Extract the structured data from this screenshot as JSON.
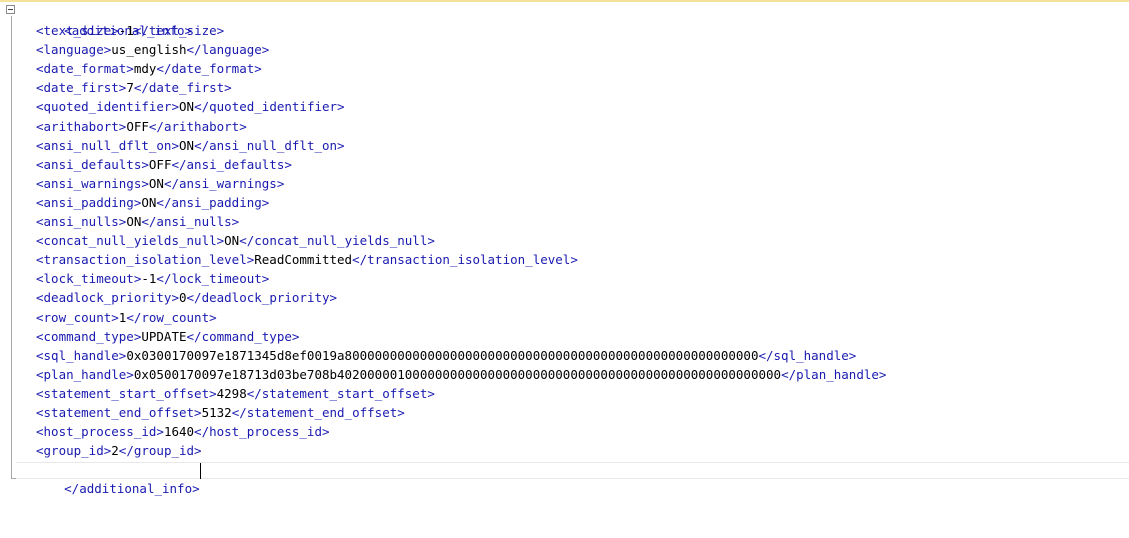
{
  "root_tag": "additional_info",
  "lines": [
    {
      "tag": "text_size",
      "value": "-1"
    },
    {
      "tag": "language",
      "value": "us_english"
    },
    {
      "tag": "date_format",
      "value": "mdy"
    },
    {
      "tag": "date_first",
      "value": "7"
    },
    {
      "tag": "quoted_identifier",
      "value": "ON"
    },
    {
      "tag": "arithabort",
      "value": "OFF"
    },
    {
      "tag": "ansi_null_dflt_on",
      "value": "ON"
    },
    {
      "tag": "ansi_defaults",
      "value": "OFF"
    },
    {
      "tag": "ansi_warnings",
      "value": "ON"
    },
    {
      "tag": "ansi_padding",
      "value": "ON"
    },
    {
      "tag": "ansi_nulls",
      "value": "ON"
    },
    {
      "tag": "concat_null_yields_null",
      "value": "ON"
    },
    {
      "tag": "transaction_isolation_level",
      "value": "ReadCommitted"
    },
    {
      "tag": "lock_timeout",
      "value": "-1"
    },
    {
      "tag": "deadlock_priority",
      "value": "0"
    },
    {
      "tag": "row_count",
      "value": "1"
    },
    {
      "tag": "command_type",
      "value": "UPDATE"
    },
    {
      "tag": "sql_handle",
      "value": "0x0300170097e1871345d8ef0019a8000000000000000000000000000000000000000000000000000000"
    },
    {
      "tag": "plan_handle",
      "value": "0x0500170097e18713d03be708b40200000100000000000000000000000000000000000000000000000000"
    },
    {
      "tag": "statement_start_offset",
      "value": "4298"
    },
    {
      "tag": "statement_end_offset",
      "value": "5132"
    },
    {
      "tag": "host_process_id",
      "value": "1640"
    },
    {
      "tag": "group_id",
      "value": "2"
    }
  ],
  "colors": {
    "tag": "#1a1ab0",
    "value": "#000000",
    "highlight_bar": "#f5e29a"
  },
  "icons": {
    "collapse": "minus-box-icon"
  }
}
